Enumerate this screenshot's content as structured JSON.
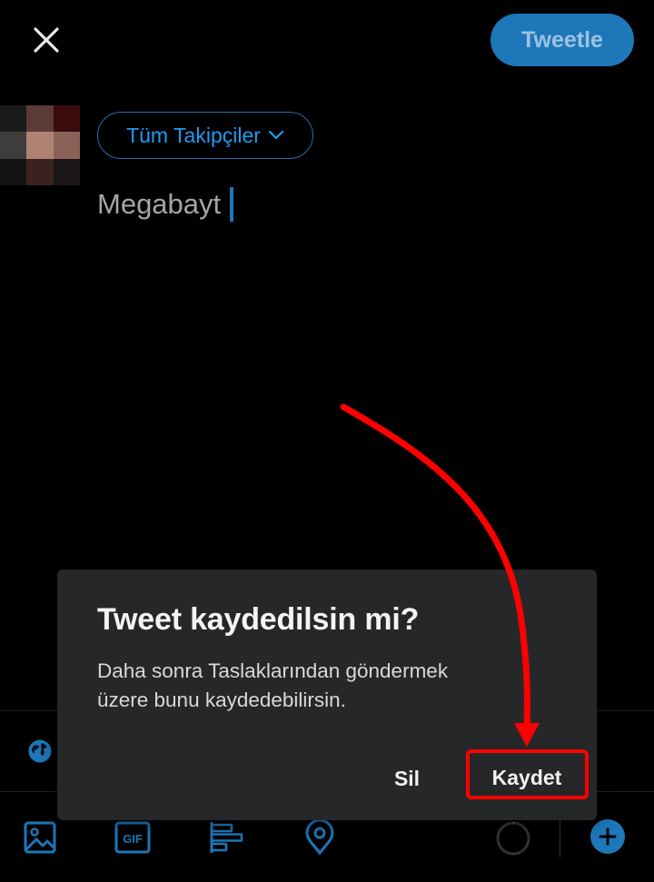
{
  "header": {
    "close_icon": "close-icon",
    "tweet_button_label": "Tweetle"
  },
  "composer": {
    "audience_label": "Tüm Takipçiler",
    "audience_icon": "chevron-down-icon",
    "text": "Megabayt"
  },
  "reply_settings": {
    "icon": "globe-icon"
  },
  "toolbar": {
    "items": [
      "image-icon",
      "gif-icon",
      "poll-icon",
      "location-icon"
    ],
    "gif_text": "GIF",
    "progress_icon": "character-count-ring",
    "add_icon": "plus-icon"
  },
  "dialog": {
    "title": "Tweet kaydedilsin mi?",
    "body_line1": "Daha sonra Taslaklarından göndermek",
    "body_line2": "üzere bunu kaydedebilirsin.",
    "delete_label": "Sil",
    "save_label": "Kaydet"
  },
  "colors": {
    "background": "#000000",
    "accent": "#1d77b8",
    "dialog_bg": "#262728",
    "annotation": "#ff0000"
  }
}
